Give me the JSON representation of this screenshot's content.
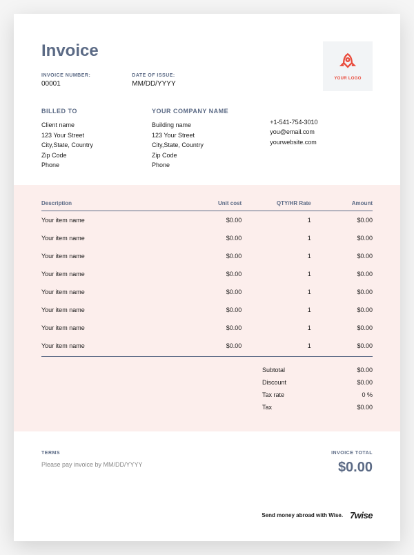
{
  "title": "Invoice",
  "meta": {
    "invoice_number_label": "INVOICE NUMBER:",
    "invoice_number": "00001",
    "date_label": "DATE OF ISSUE:",
    "date": "MM/DD/YYYY"
  },
  "logo": {
    "text": "YOUR LOGO"
  },
  "billed_to": {
    "label": "BILLED TO",
    "lines": [
      "Client name",
      "123 Your Street",
      "City,State, Country",
      "Zip Code",
      "Phone"
    ]
  },
  "company": {
    "label": "YOUR COMPANY NAME",
    "lines": [
      "Building name",
      "123 Your Street",
      "City,State, Country",
      "Zip Code",
      "Phone"
    ]
  },
  "contact": {
    "lines": [
      "+1-541-754-3010",
      "you@email.com",
      "yourwebsite.com"
    ]
  },
  "table": {
    "headers": {
      "desc": "Description",
      "cost": "Unit cost",
      "qty": "QTY/HR Rate",
      "amt": "Amount"
    },
    "rows": [
      {
        "desc": "Your item name",
        "cost": "$0.00",
        "qty": "1",
        "amt": "$0.00"
      },
      {
        "desc": "Your item name",
        "cost": "$0.00",
        "qty": "1",
        "amt": "$0.00"
      },
      {
        "desc": "Your item name",
        "cost": "$0.00",
        "qty": "1",
        "amt": "$0.00"
      },
      {
        "desc": "Your item name",
        "cost": "$0.00",
        "qty": "1",
        "amt": "$0.00"
      },
      {
        "desc": "Your item name",
        "cost": "$0.00",
        "qty": "1",
        "amt": "$0.00"
      },
      {
        "desc": "Your item name",
        "cost": "$0.00",
        "qty": "1",
        "amt": "$0.00"
      },
      {
        "desc": "Your item name",
        "cost": "$0.00",
        "qty": "1",
        "amt": "$0.00"
      },
      {
        "desc": "Your item name",
        "cost": "$0.00",
        "qty": "1",
        "amt": "$0.00"
      }
    ]
  },
  "totals": {
    "subtotal_label": "Subtotal",
    "subtotal": "$0.00",
    "discount_label": "Discount",
    "discount": "$0.00",
    "taxrate_label": "Tax rate",
    "taxrate": "0 %",
    "tax_label": "Tax",
    "tax": "$0.00"
  },
  "terms": {
    "label": "TERMS",
    "text": "Please pay invoice by MM/DD/YYYY"
  },
  "invoice_total": {
    "label": "INVOICE TOTAL",
    "value": "$0.00"
  },
  "wise": {
    "text": "Send money abroad with Wise.",
    "logo": "7wise"
  }
}
